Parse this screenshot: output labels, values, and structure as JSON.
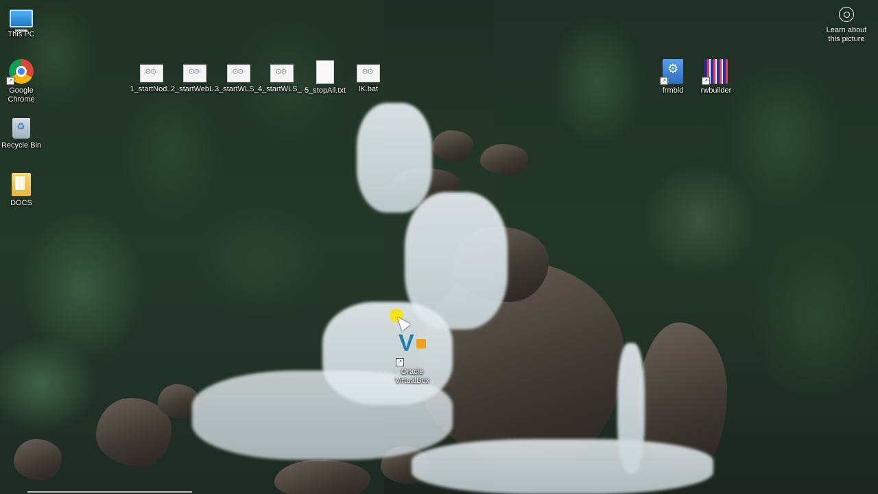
{
  "desktop": {
    "left_icons": [
      {
        "label": "This PC",
        "icon": "computer-icon"
      },
      {
        "label": "Google Chrome",
        "icon": "chrome-icon"
      },
      {
        "label": "Recycle Bin",
        "icon": "recycle-bin-icon"
      },
      {
        "label": "DOCS",
        "icon": "folder-icon"
      }
    ],
    "top_icons": [
      {
        "label": "1_startNod...",
        "icon": "batch-file-icon"
      },
      {
        "label": "2_startWebL...",
        "icon": "batch-file-icon"
      },
      {
        "label": "3_startWLS_...",
        "icon": "batch-file-icon"
      },
      {
        "label": "4_startWLS_...",
        "icon": "batch-file-icon"
      },
      {
        "label": "5_stopAll.txt",
        "icon": "text-file-icon"
      },
      {
        "label": "lK.bat",
        "icon": "batch-file-icon"
      }
    ],
    "right_icons": [
      {
        "label": "frmbld",
        "icon": "forms-builder-icon"
      },
      {
        "label": "rwbuilder",
        "icon": "reports-builder-icon"
      }
    ],
    "center_icon": {
      "label": "Oracle VirtualBox",
      "icon": "virtualbox-icon"
    },
    "learn_picture": {
      "label": "Learn about this picture",
      "icon": "camera-icon"
    }
  }
}
